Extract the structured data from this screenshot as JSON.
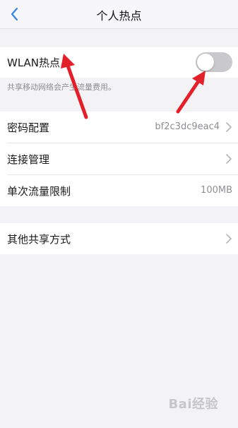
{
  "header": {
    "title": "个人热点",
    "back_icon": "chevron-left-icon",
    "accent_color": "#2f84e7"
  },
  "wlan": {
    "label": "WLAN热点",
    "toggle_state": "off",
    "hint": "共享移动网络会产生流量费用。"
  },
  "settings": {
    "password": {
      "label": "密码配置",
      "value": "bf2c3dc9eac4"
    },
    "connection": {
      "label": "连接管理"
    },
    "data_limit": {
      "label": "单次流量限制",
      "value": "100MB"
    },
    "other_sharing": {
      "label": "其他共享方式"
    }
  },
  "annotations": {
    "arrow_color": "#e3202a"
  },
  "watermark": {
    "text": "Bai经验"
  }
}
